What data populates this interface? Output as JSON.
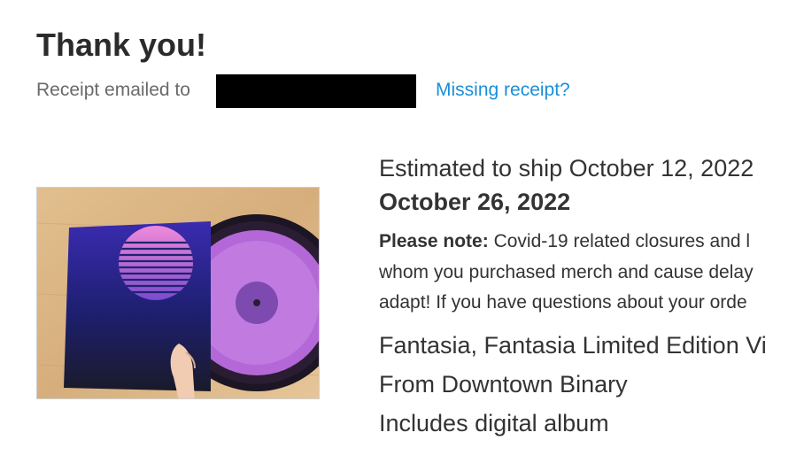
{
  "header": {
    "title": "Thank you!",
    "receipt_label": "Receipt emailed to",
    "missing_receipt_link": "Missing receipt?"
  },
  "colors": {
    "link": "#1a8fd8",
    "redaction": "#000000"
  },
  "order": {
    "ship_estimate": "Estimated to ship October 12, 2022",
    "ship_estimate_end": "October 26, 2022",
    "note_label": "Please note:",
    "note_line1": "Covid-19 related closures and l",
    "note_line2": "whom you purchased merch and cause delay",
    "note_line3": "adapt! If you have questions about your orde",
    "item_title": "Fantasia, Fantasia Limited Edition Vi",
    "item_artist": "From Downtown Binary",
    "item_extra": "Includes digital album"
  }
}
